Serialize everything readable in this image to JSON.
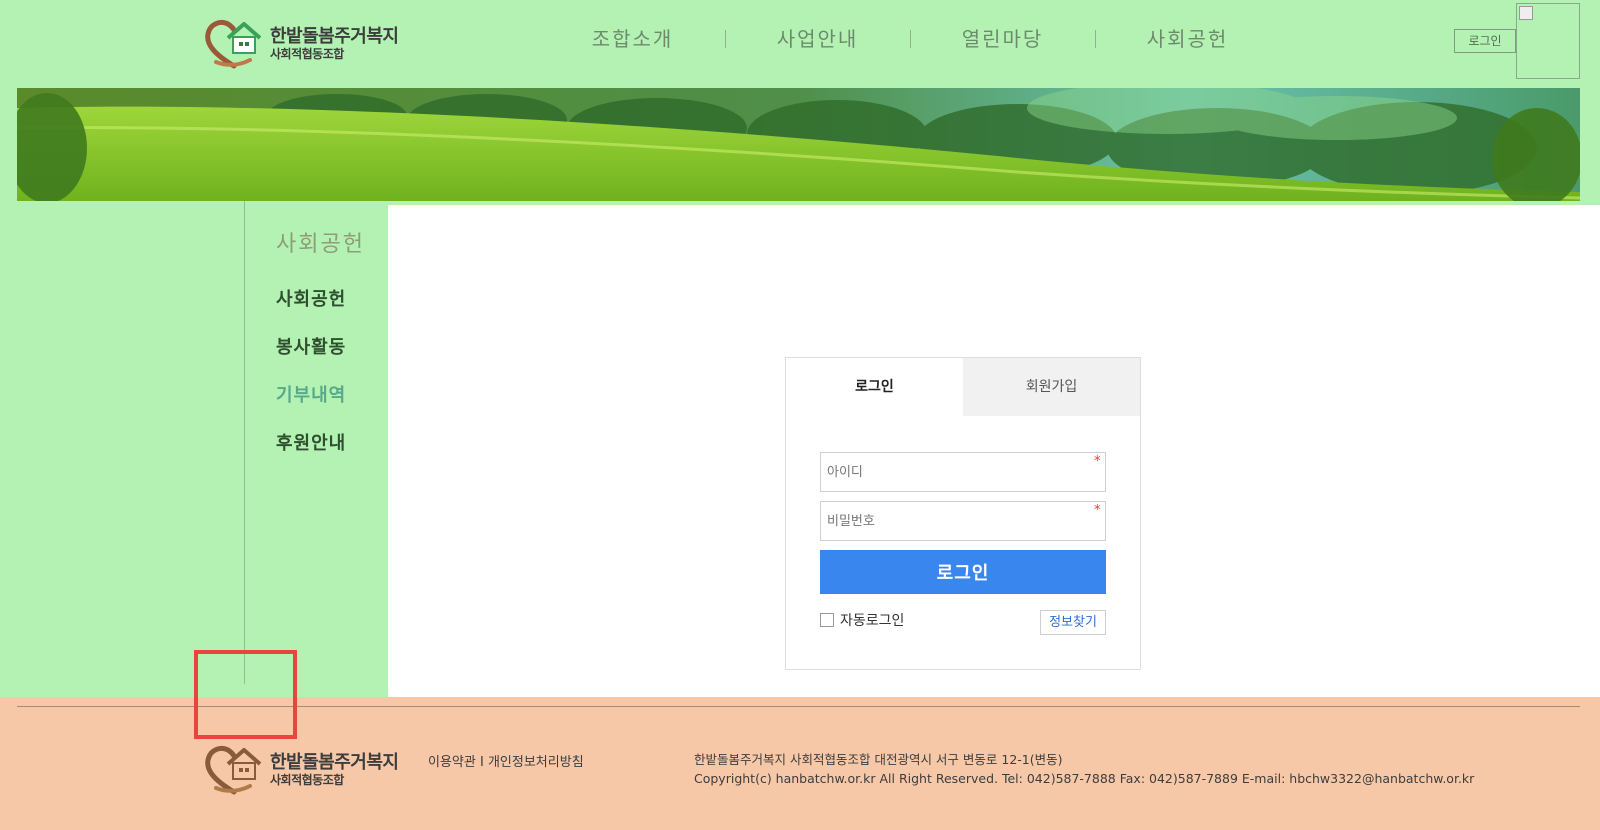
{
  "brand": {
    "name": "한밭돌봄주거복지",
    "sub": "사회적협동조합"
  },
  "nav": {
    "items": [
      "조합소개",
      "사업안내",
      "열린마당",
      "사회공헌"
    ],
    "login": "로그인"
  },
  "sidebar": {
    "title": "사회공헌",
    "items": [
      {
        "label": "사회공헌",
        "active": false
      },
      {
        "label": "봉사활동",
        "active": false
      },
      {
        "label": "기부내역",
        "active": true
      },
      {
        "label": "후원안내",
        "active": false
      }
    ]
  },
  "login_form": {
    "tab_login": "로그인",
    "tab_join": "회원가입",
    "id_placeholder": "아이디",
    "pw_placeholder": "비밀번호",
    "required_mark": "*",
    "submit": "로그인",
    "auto_login": "자동로그인",
    "find_info": "정보찾기"
  },
  "footer": {
    "terms": "이용약관",
    "separator": "I",
    "privacy": "개인정보처리방침",
    "address": "한밭돌봄주거복지 사회적협동조합 대전광역시 서구 변동로 12-1(변동)",
    "copyright": "Copyright(c) hanbatchw.or.kr All Right Reserved. Tel: 042)587-7888 Fax: 042)587-7889 E-mail: hbchw3322@hanbatchw.or.kr"
  },
  "colors": {
    "page_bg": "#b3f2b3",
    "footer_bg": "#f7c8a8",
    "accent_blue": "#3a86ef",
    "highlight_red": "#e8453c"
  }
}
